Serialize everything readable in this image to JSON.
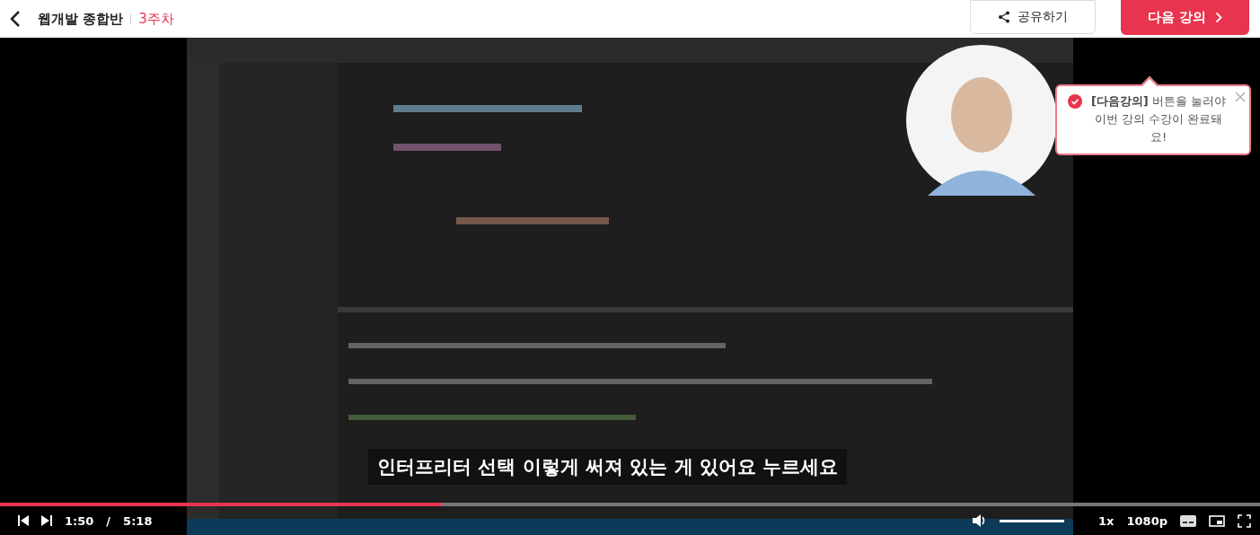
{
  "header": {
    "course": "웹개발 종합반",
    "week": "3주차",
    "share_button": "공유하기",
    "next_button": "다음 강의"
  },
  "toast": {
    "text": "**[다음강의]** 버튼을 눌러야 이번 강의 수강이 완료돼요!"
  },
  "video": {
    "kind": "picture",
    "subtitle": "인터프리터 선택 이렇게 써져 있는 게 있어요 누르세요"
  },
  "player": {
    "progress": {
      "level": 0.35
    },
    "current_time": "1:50",
    "separator": "/",
    "duration": "5:18",
    "volume": {
      "level": 1
    },
    "speed": "1x",
    "quality": "1080p"
  }
}
